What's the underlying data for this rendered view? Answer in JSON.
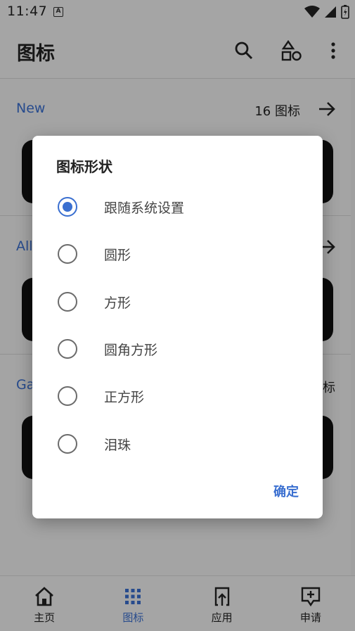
{
  "status": {
    "time": "11:47",
    "notification_letter": "A"
  },
  "app_bar": {
    "title": "图标"
  },
  "sections": [
    {
      "title": "New",
      "count": "16 图标"
    },
    {
      "title": "All"
    },
    {
      "title": "Ga",
      "count_fragment": "标"
    }
  ],
  "dialog": {
    "title": "图标形状",
    "options": [
      {
        "label": "跟随系统设置",
        "checked": true
      },
      {
        "label": "圆形",
        "checked": false
      },
      {
        "label": "方形",
        "checked": false
      },
      {
        "label": "圆角方形",
        "checked": false
      },
      {
        "label": "正方形",
        "checked": false
      },
      {
        "label": "泪珠",
        "checked": false
      }
    ],
    "confirm_label": "确定"
  },
  "bottom_nav": {
    "items": [
      {
        "label": "主页",
        "icon": "home-icon"
      },
      {
        "label": "图标",
        "icon": "grid-icon",
        "active": true
      },
      {
        "label": "应用",
        "icon": "app-upload-icon"
      },
      {
        "label": "申请",
        "icon": "request-icon"
      }
    ]
  },
  "colors": {
    "accent": "#3a6fd0",
    "scrim": "rgba(0,0,0,0.32)"
  }
}
